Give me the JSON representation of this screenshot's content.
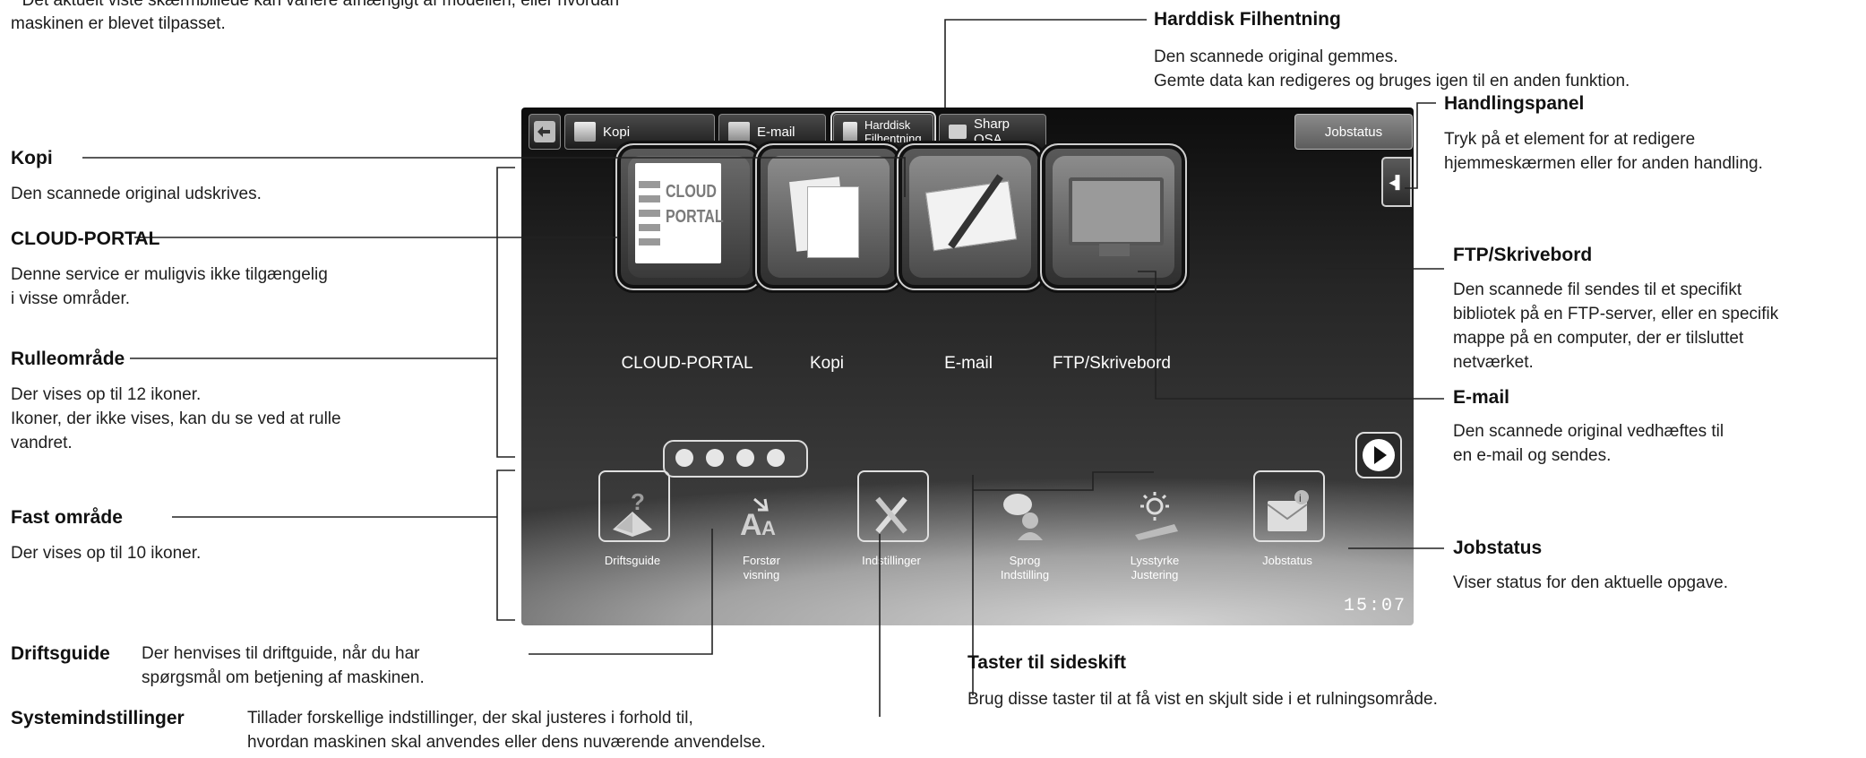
{
  "footnote": "* Det aktuelt viste skærmbillede kan variere afhængigt af modellen, eller hvordan\nmaskinen er blevet tilpasset.",
  "screen": {
    "tabs": [
      "Kopi",
      "E-mail",
      "Harddisk\nFilhentning",
      "Sharp OSA"
    ],
    "jobstatus_button": "Jobstatus",
    "main_icons": [
      "CLOUD-PORTAL",
      "Kopi",
      "E-mail",
      "FTP/Skrivebord"
    ],
    "cloud_logo": "CLOUD\nPORTAL",
    "fixed_icons": [
      "Driftsguide",
      "Forstør\nvisning",
      "Indstillinger",
      "Sprog\nIndstilling",
      "Lysstyrke\nJustering",
      "Jobstatus"
    ],
    "clock": "15:07"
  },
  "callouts": {
    "kopi": {
      "title": "Kopi",
      "text": "Den scannede original udskrives."
    },
    "cloud": {
      "title": "CLOUD-PORTAL",
      "text": "Denne service er muligvis ikke tilgængelig\ni visse områder."
    },
    "rulle": {
      "title": "Rulleområde",
      "text": "Der vises op til 12 ikoner.\nIkoner, der ikke vises, kan du se ved at rulle\nvandret."
    },
    "fast": {
      "title": "Fast område",
      "text": "Der vises op til 10 ikoner."
    },
    "driftsguide": {
      "title": "Driftsguide",
      "text": "Der henvises til driftguide, når du har\nspørgsmål om betjening af maskinen."
    },
    "system": {
      "title": "Systemindstillinger",
      "text": "Tillader forskellige indstillinger, der skal justeres i forhold til,\nhvordan maskinen skal anvendes eller dens nuværende anvendelse."
    },
    "harddisk": {
      "title": "Harddisk Filhentning",
      "text": "Den scannede original gemmes.\nGemte data kan redigeres og bruges igen til en anden funktion."
    },
    "handling": {
      "title": "Handlingspanel",
      "text": "Tryk på et element for at redigere\nhjemmeskærmen eller for anden handling."
    },
    "ftp": {
      "title": "FTP/Skrivebord",
      "text": "Den scannede fil sendes til et specifikt\nbibliotek på en FTP-server, eller en specifik\nmappe på en computer, der er tilsluttet\nnetværket."
    },
    "email": {
      "title": "E-mail",
      "text": "Den scannede original vedhæftes til\nen e-mail og sendes."
    },
    "jobstatus": {
      "title": "Jobstatus",
      "text": "Viser status for den aktuelle opgave."
    },
    "taster": {
      "title": "Taster til sideskift",
      "text": "Brug disse taster til at få vist en skjult side i et rulningsområde."
    }
  }
}
